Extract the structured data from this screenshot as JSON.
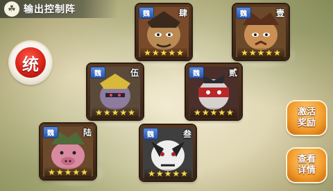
{
  "header": {
    "title": "输出控制阵",
    "icon": "paw-icon"
  },
  "tong_button": {
    "label": "统"
  },
  "cards": [
    {
      "id": "card-4",
      "faction": "魏",
      "order": "肆",
      "stars": 5,
      "frame": "#7a4b2a",
      "face": "#b98a54",
      "accent": "#3b2a1c"
    },
    {
      "id": "card-1",
      "faction": "魏",
      "order": "壹",
      "stars": 5,
      "frame": "#6b4a2a",
      "face": "#c98f55",
      "accent": "#5a2f1b"
    },
    {
      "id": "card-5",
      "faction": "魏",
      "order": "伍",
      "stars": 5,
      "frame": "#5a4a3a",
      "face": "#8e7c9e",
      "accent": "#d8b93a"
    },
    {
      "id": "card-2",
      "faction": "魏",
      "order": "贰",
      "stars": 5,
      "frame": "#4a2f2a",
      "face": "#d6d1cf",
      "accent": "#b8282a"
    },
    {
      "id": "card-6",
      "faction": "魏",
      "order": "陆",
      "stars": 5,
      "frame": "#6a4a2a",
      "face": "#d98aa0",
      "accent": "#4f6b3a"
    },
    {
      "id": "card-3",
      "faction": "魏",
      "order": "叁",
      "stars": 5,
      "frame": "#3f3f3f",
      "face": "#eeeeee",
      "accent": "#b0222a"
    }
  ],
  "side_buttons": [
    {
      "id": "activate-bonus",
      "label": "激活奖励"
    },
    {
      "id": "view-details",
      "label": "查看详情"
    }
  ]
}
